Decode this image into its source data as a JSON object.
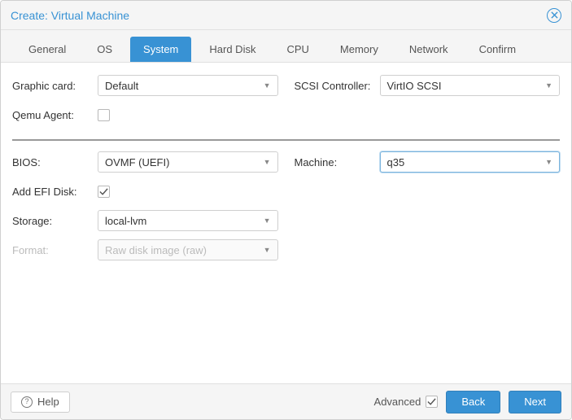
{
  "window": {
    "title": "Create: Virtual Machine"
  },
  "tabs": [
    {
      "label": "General"
    },
    {
      "label": "OS"
    },
    {
      "label": "System"
    },
    {
      "label": "Hard Disk"
    },
    {
      "label": "CPU"
    },
    {
      "label": "Memory"
    },
    {
      "label": "Network"
    },
    {
      "label": "Confirm"
    }
  ],
  "active_tab_index": 2,
  "form": {
    "graphic_card": {
      "label": "Graphic card:",
      "value": "Default"
    },
    "scsi_controller": {
      "label": "SCSI Controller:",
      "value": "VirtIO SCSI"
    },
    "qemu_agent": {
      "label": "Qemu Agent:",
      "checked": false
    },
    "bios": {
      "label": "BIOS:",
      "value": "OVMF (UEFI)"
    },
    "machine": {
      "label": "Machine:",
      "value": "q35"
    },
    "add_efi_disk": {
      "label": "Add EFI Disk:",
      "checked": true
    },
    "storage": {
      "label": "Storage:",
      "value": "local-lvm"
    },
    "format": {
      "label": "Format:",
      "value": "Raw disk image (raw)",
      "disabled": true
    }
  },
  "footer": {
    "help": "Help",
    "advanced": {
      "label": "Advanced",
      "checked": true
    },
    "back": "Back",
    "next": "Next"
  }
}
